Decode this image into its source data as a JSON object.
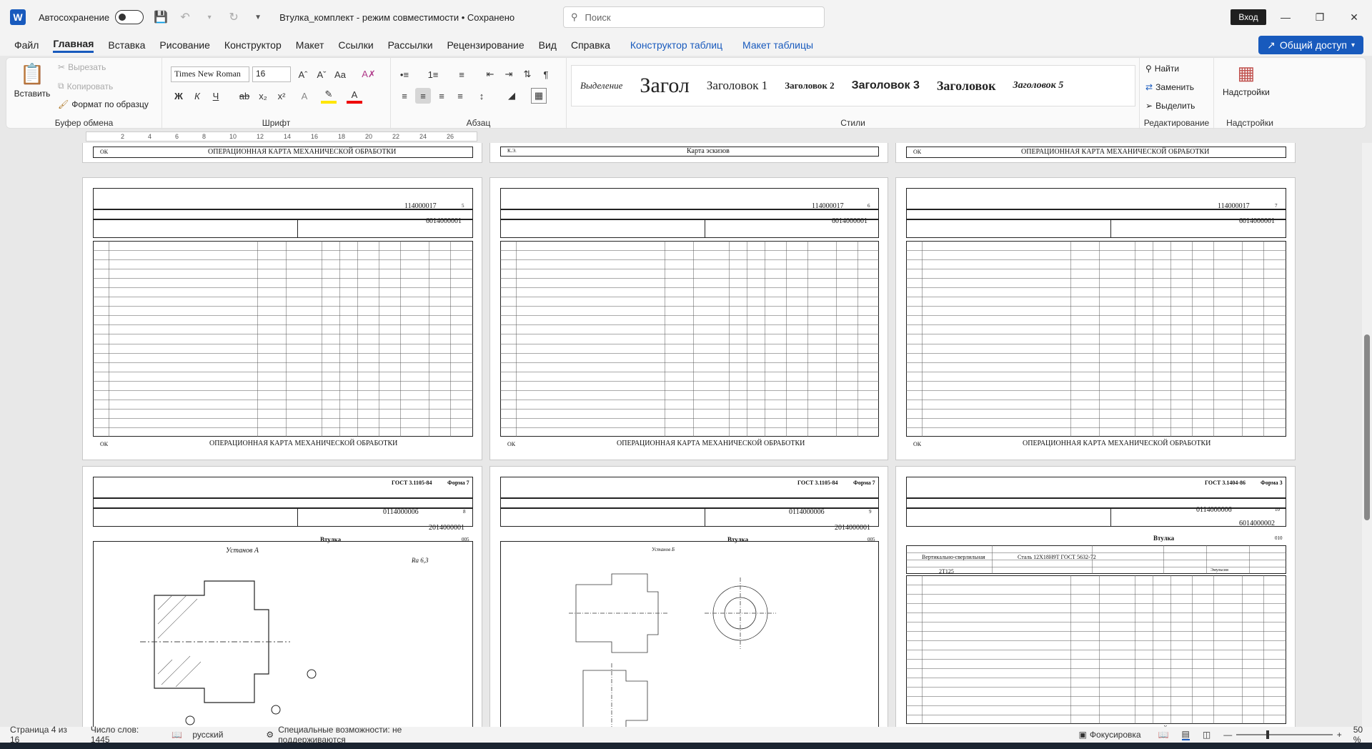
{
  "titlebar": {
    "autosave_label": "Автосохранение",
    "doc_title": "Втулка_комплект  -  режим совместимости  •  Сохранено",
    "search_placeholder": "Поиск",
    "signin_label": "Вход"
  },
  "menu": {
    "items": [
      "Файл",
      "Главная",
      "Вставка",
      "Рисование",
      "Конструктор",
      "Макет",
      "Ссылки",
      "Рассылки",
      "Рецензирование",
      "Вид",
      "Справка"
    ],
    "context_items": [
      "Конструктор таблиц",
      "Макет таблицы"
    ],
    "share_label": "Общий доступ"
  },
  "ribbon": {
    "clipboard": {
      "paste": "Вставить",
      "cut": "Вырезать",
      "copy": "Копировать",
      "format_painter": "Формат по образцу",
      "label": "Буфер обмена"
    },
    "font": {
      "name": "Times New Roman",
      "size": "16",
      "label": "Шрифт"
    },
    "paragraph": {
      "label": "Абзац"
    },
    "styles": {
      "items": [
        "Выделение",
        "Загол",
        "Заголовок 1",
        "Заголовок 2",
        "Заголовок 3",
        "Заголовок",
        "Заголовок 5"
      ],
      "label": "Стили"
    },
    "editing": {
      "find": "Найти",
      "replace": "Заменить",
      "select": "Выделить",
      "label": "Редактирование"
    },
    "addins": {
      "button": "Надстройки",
      "label": "Надстройки"
    }
  },
  "ruler": {
    "numbers": [
      "2",
      "4",
      "6",
      "8",
      "10",
      "12",
      "14",
      "16",
      "18",
      "20",
      "22",
      "24",
      "26"
    ]
  },
  "pages": {
    "footer_text": "ОПЕРАЦИОННАЯ КАРТА МЕХАНИЧЕСКОЙ ОБРАБОТКИ",
    "sketch_footer": "Карта эскизов",
    "ok": "ОК",
    "ks": "К.Э.",
    "row1": [
      {
        "code": "114000017",
        "doc": "6014000001",
        "sheet": "5"
      },
      {
        "code": "114000017",
        "doc": "6014000001",
        "sheet": "6"
      },
      {
        "code": "114000017",
        "doc": "6014000001",
        "sheet": "7"
      }
    ],
    "row2": [
      {
        "gost": "ГОСТ 3.1105-84",
        "form": "Форма 7",
        "code": "0114000006",
        "doc": "2014000001",
        "sheet": "8",
        "part": "Втулка",
        "op": "005",
        "setup": "Установ А",
        "ra": "Ra 6,3"
      },
      {
        "gost": "ГОСТ 3.1105-84",
        "form": "Форма 7",
        "code": "0114000006",
        "doc": "2014000001",
        "sheet": "9",
        "part": "Втулка",
        "op": "005",
        "setup": "Установ Б"
      },
      {
        "gost": "ГОСТ 3.1404-86",
        "form": "Форма 3",
        "code": "0114000006",
        "doc": "6014000002",
        "sheet": "10",
        "part": "Втулка",
        "op": "010",
        "operation": "Вертикально-сверлильная",
        "material": "Сталь 12Х18Н9Т ГОСТ 5632-72",
        "machine": "2Т125",
        "coolant": "Эмульсия"
      }
    ]
  },
  "status": {
    "page": "Страница 4 из 16",
    "words": "Число слов: 1445",
    "lang": "русский",
    "access": "Специальные возможности: не поддерживаются",
    "focus": "Фокусировка",
    "zoom": "50 %"
  }
}
